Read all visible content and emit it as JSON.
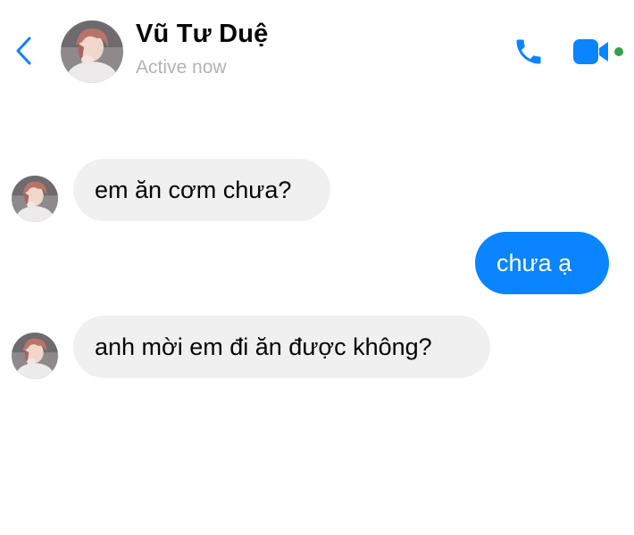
{
  "header": {
    "back_icon": "chevron-left-icon",
    "name": "Vũ Tư Duệ",
    "status": "Active now",
    "call_icon": "phone-icon",
    "video_icon": "video-camera-icon",
    "online_dot_color": "#31a24c",
    "accent_color": "#0a84ff"
  },
  "messages": [
    {
      "direction": "incoming",
      "text": "em ăn cơm chưa?"
    },
    {
      "direction": "outgoing",
      "text": "chưa ạ"
    },
    {
      "direction": "incoming",
      "text": "anh mời em đi ăn được không?"
    }
  ],
  "colors": {
    "incoming_bubble": "#f0f0f0",
    "outgoing_bubble": "#0a84ff",
    "status_text": "#b0b3b8"
  }
}
